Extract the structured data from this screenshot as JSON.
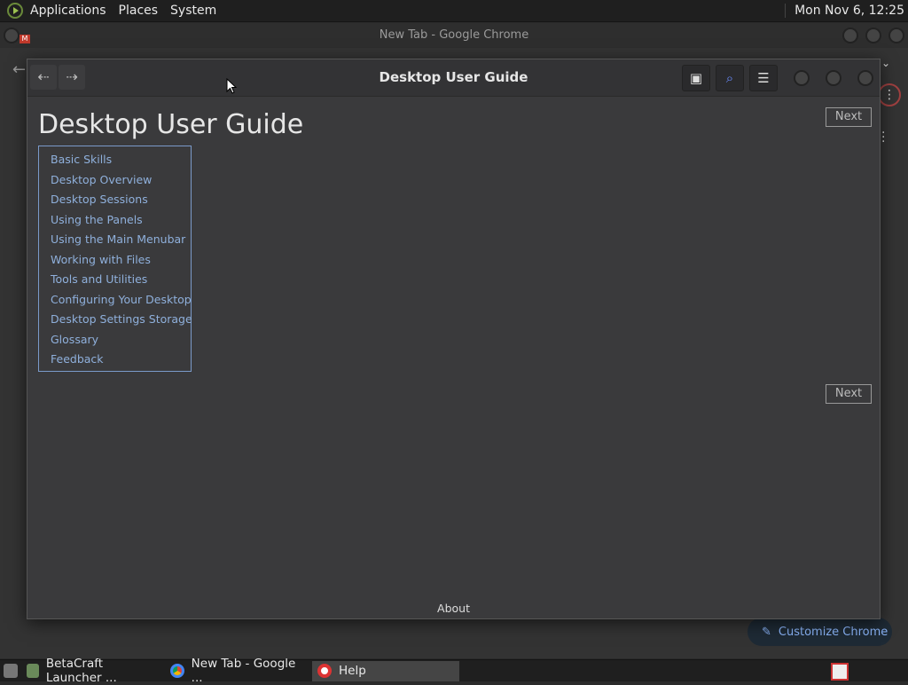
{
  "top_panel": {
    "menus": [
      "Applications",
      "Places",
      "System"
    ],
    "clock": "Mon Nov  6, 12:25"
  },
  "chrome": {
    "window_title": "New Tab - Google Chrome",
    "customize_label": "Customize Chrome"
  },
  "help": {
    "header_title": "Desktop User Guide",
    "doc_title": "Desktop User Guide",
    "next_label": "Next",
    "toc": [
      "Basic Skills",
      "Desktop Overview",
      "Desktop Sessions",
      "Using the Panels",
      "Using the Main Menubar",
      "Working with Files",
      "Tools and Utilities",
      "Configuring Your Desktop",
      "Desktop Settings Storage",
      "Glossary",
      "Feedback"
    ],
    "about_label": "About"
  },
  "taskbar": {
    "tasks": [
      {
        "label": "BetaCraft Launcher ...",
        "icon": "betacraft-icon"
      },
      {
        "label": "New Tab - Google ...",
        "icon": "chrome-icon"
      },
      {
        "label": "Help",
        "icon": "lifebuoy-icon"
      }
    ]
  },
  "colors": {
    "link": "#8fb0dc",
    "toc_border": "#7a9ac9",
    "chrome_accent": "#8ab4f8"
  }
}
